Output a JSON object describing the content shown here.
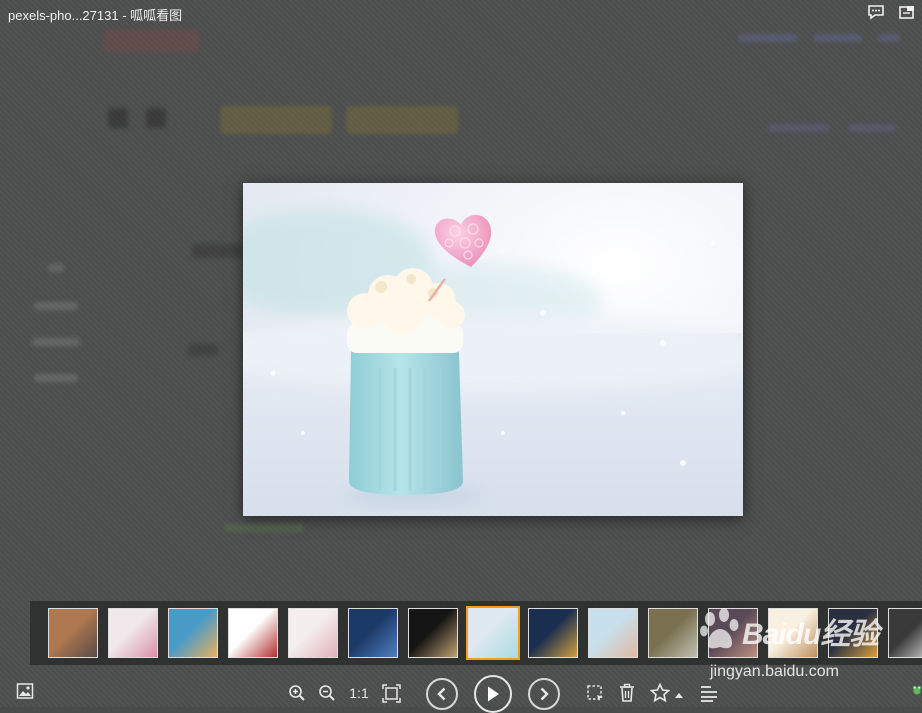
{
  "window": {
    "file_name": "pexels-pho...27131",
    "separator": " - ",
    "app_name": "呱呱看图"
  },
  "toolbar": {
    "actual_size_label": "1:1"
  },
  "watermark": {
    "logo_text": "Baidu经验",
    "url": "jingyan.baidu.com"
  },
  "filmstrip": {
    "active_index": 7,
    "thumbnails": [
      {
        "subject": "city-skyline",
        "colors": [
          "#b07850",
          "#5a4a48"
        ]
      },
      {
        "subject": "pink-flowers-cups",
        "colors": [
          "#f0e8ea",
          "#d890a8"
        ]
      },
      {
        "subject": "girl-by-sea",
        "colors": [
          "#4a9ac8",
          "#e8b060"
        ]
      },
      {
        "subject": "book-with-hearts",
        "colors": [
          "#ffffff",
          "#b03030"
        ]
      },
      {
        "subject": "hands-holding-heart",
        "colors": [
          "#f4eeee",
          "#e0b0b8"
        ]
      },
      {
        "subject": "blue-night-lights",
        "colors": [
          "#1c3a68",
          "#5080c0"
        ]
      },
      {
        "subject": "heart-in-dark",
        "colors": [
          "#141414",
          "#c0a070"
        ]
      },
      {
        "subject": "cup-in-snow",
        "colors": [
          "#dde8f0",
          "#a8dce0"
        ]
      },
      {
        "subject": "gold-bars",
        "colors": [
          "#1a2e50",
          "#d0a040"
        ]
      },
      {
        "subject": "holding-hands",
        "colors": [
          "#c8e0ec",
          "#e0b8a0"
        ]
      },
      {
        "subject": "cat-on-rocks",
        "colors": [
          "#7a7050",
          "#c0c0b0"
        ]
      },
      {
        "subject": "couple-portrait",
        "colors": [
          "#5a4a58",
          "#c09080"
        ]
      },
      {
        "subject": "paw-print",
        "colors": [
          "#f8f0e0",
          "#c09060"
        ]
      },
      {
        "subject": "golden-statue",
        "colors": [
          "#2a3040",
          "#d8a040"
        ]
      },
      {
        "subject": "desk-writing",
        "colors": [
          "#3a3a3a",
          "#e0e0e0"
        ]
      }
    ]
  },
  "photo": {
    "subject": "knitted-cup-with-cream-and-heart-lollipop-in-snow",
    "colors": {
      "sky": "#f2f4f8",
      "snow": "#e8eef6",
      "cup": "#a8dde2",
      "cream": "#fff8ec",
      "heart": "#f2a6c8"
    }
  },
  "colors": {
    "accent": "#f0a020",
    "filmstrip_bg": "#303131",
    "icon": "#e8e8e8"
  }
}
